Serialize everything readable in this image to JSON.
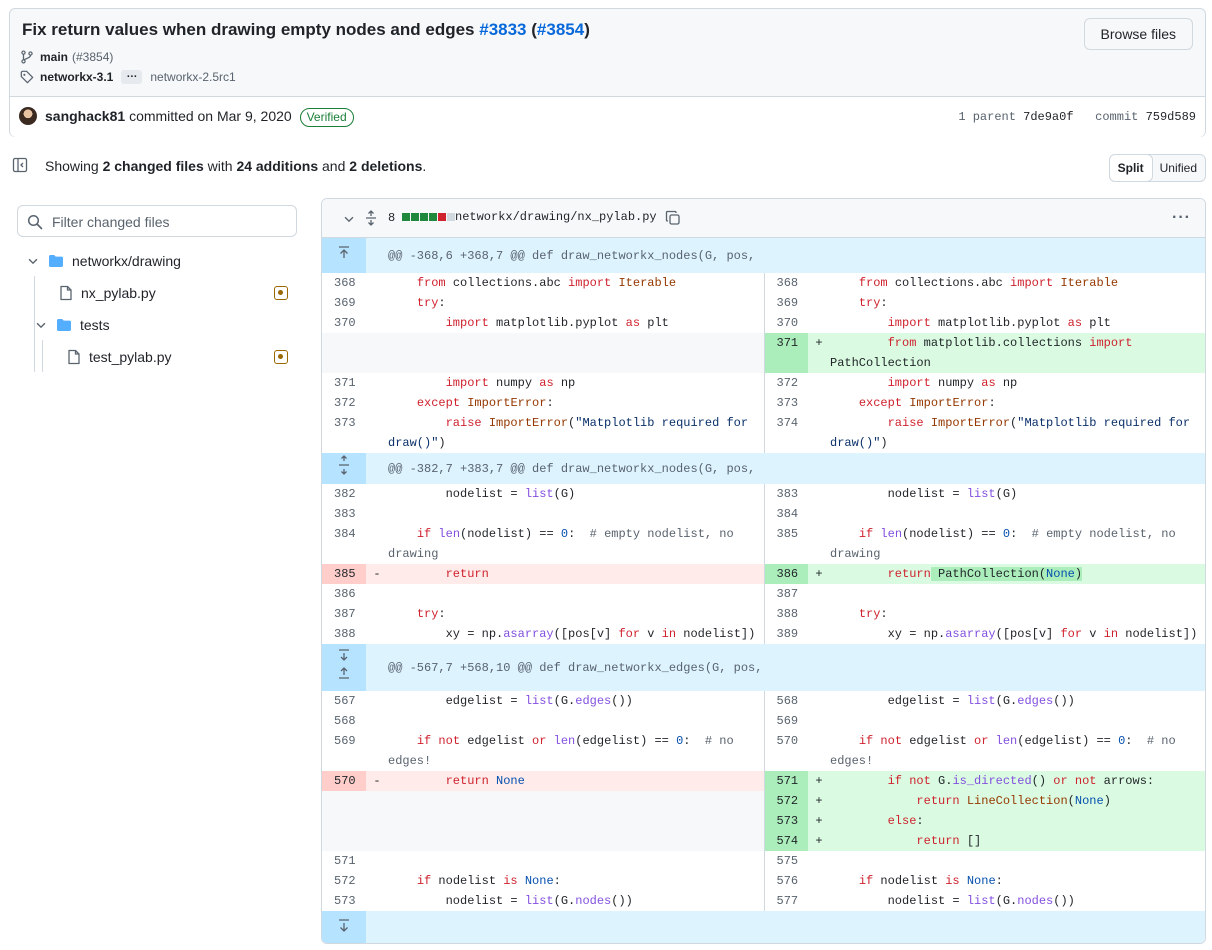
{
  "commit": {
    "title": "Fix return values when drawing empty nodes and edges",
    "issue_ref": "#3833",
    "pr_ref": "#3854",
    "browse_label": "Browse files",
    "branch": "main",
    "branch_pr": "(#3854)",
    "tag": "networkx-3.1",
    "tag_more": "…",
    "tag2": "networkx-2.5rc1",
    "author": "sanghack81",
    "committed_text": "committed on Mar 9, 2020",
    "verified": "Verified",
    "parent_label": "1 parent",
    "parent_sha": "7de9a0f",
    "commit_label": "commit",
    "commit_sha": "759d589"
  },
  "summary": {
    "showing": "Showing",
    "files": "2 changed files",
    "with": "with",
    "additions": "24 additions",
    "and": "and",
    "deletions": "2 deletions",
    "period": ".",
    "split": "Split",
    "unified": "Unified"
  },
  "sidebar": {
    "filter_placeholder": "Filter changed files",
    "tree": [
      {
        "type": "folder",
        "name": "networkx/drawing"
      },
      {
        "type": "file",
        "name": "nx_pylab.py",
        "status": "modified"
      },
      {
        "type": "folder",
        "name": "tests"
      },
      {
        "type": "file",
        "name": "test_pylab.py",
        "status": "modified"
      }
    ]
  },
  "diff": {
    "change_count": "8",
    "file_path": "networkx/drawing/nx_pylab.py",
    "hunk1": "@@ -368,6 +368,7 @@ def draw_networkx_nodes(G, pos,",
    "hunk2": "@@ -382,7 +383,7 @@ def draw_networkx_nodes(G, pos,",
    "hunk3": "@@ -567,7 +568,10 @@ def draw_networkx_edges(G, pos,"
  }
}
